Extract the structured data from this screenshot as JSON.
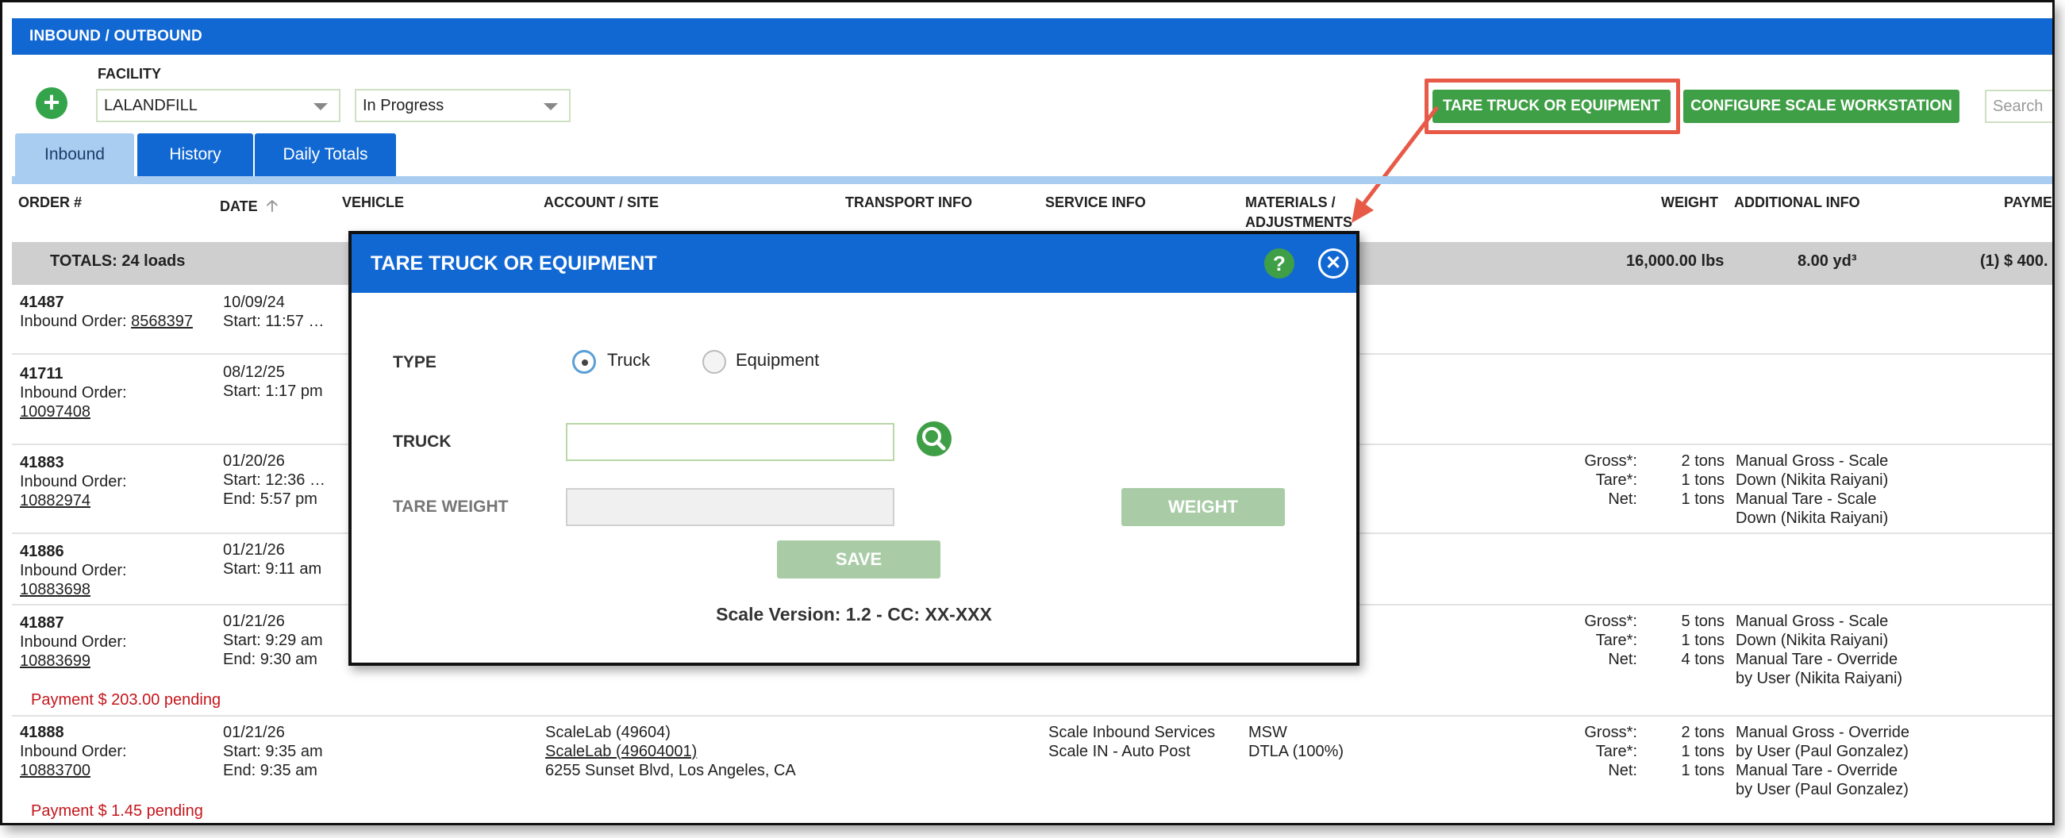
{
  "page": {
    "section_title": "INBOUND / OUTBOUND",
    "facility_label": "FACILITY",
    "facility_value": "LALANDFILL",
    "status_value": "In Progress",
    "tare_button": "TARE TRUCK OR EQUIPMENT",
    "configure_button": "CONFIGURE SCALE WORKSTATION",
    "search_placeholder": "Search"
  },
  "tabs": [
    {
      "label": "Inbound",
      "active": true
    },
    {
      "label": "History",
      "active": false
    },
    {
      "label": "Daily Totals",
      "active": false
    }
  ],
  "columns": {
    "order": "ORDER #",
    "date": "DATE",
    "vehicle": "VEHICLE",
    "account": "ACCOUNT / SITE",
    "transport": "TRANSPORT INFO",
    "service": "SERVICE INFO",
    "materials_line1": "MATERIALS /",
    "materials_line2": "ADJUSTMENTS",
    "weight": "WEIGHT",
    "additional": "ADDITIONAL INFO",
    "payment": "PAYME"
  },
  "totals": {
    "label": "TOTALS: 24 loads",
    "weight": "16,000.00 lbs",
    "volume": "8.00 yd³",
    "payment": "(1) $ 400."
  },
  "rows": [
    {
      "order": "41487",
      "order_label": "Inbound Order:",
      "order_link": "8568397",
      "date": "10/09/24",
      "start": "Start: 11:57 …"
    },
    {
      "order": "41711",
      "order_label": "Inbound Order:",
      "order_link": "10097408",
      "date": "08/12/25",
      "start": "Start: 1:17 pm"
    },
    {
      "order": "41883",
      "order_label": "Inbound Order:",
      "order_link": "10882974",
      "date": "01/20/26",
      "start": "Start: 12:36 …",
      "end": "End: 5:57 pm",
      "gross_label": "Gross*:",
      "gross": "2 tons",
      "tare_label": "Tare*:",
      "tare": "1 tons",
      "net_label": "Net:",
      "net": "1 tons",
      "info1": "Manual Gross - Scale",
      "info2": "Down (Nikita Raiyani)",
      "info3": "Manual Tare - Scale",
      "info4": "Down (Nikita Raiyani)"
    },
    {
      "order": "41886",
      "order_label": "Inbound Order:",
      "order_link": "10883698",
      "date": "01/21/26",
      "start": "Start: 9:11 am"
    },
    {
      "order": "41887",
      "order_label": "Inbound Order:",
      "order_link": "10883699",
      "date": "01/21/26",
      "start": "Start: 9:29 am",
      "end": "End: 9:30 am",
      "gross_label": "Gross*:",
      "gross": "5 tons",
      "tare_label": "Tare*:",
      "tare": "1 tons",
      "net_label": "Net:",
      "net": "4 tons",
      "info1": "Manual Gross - Scale",
      "info2": "Down (Nikita Raiyani)",
      "info3": "Manual Tare - Override",
      "info4": "by User (Nikita Raiyani)",
      "pending": "Payment $ 203.00 pending"
    },
    {
      "order": "41888",
      "order_label": "Inbound Order:",
      "order_link": "10883700",
      "date": "01/21/26",
      "start": "Start: 9:35 am",
      "end": "End: 9:35 am",
      "account1": "ScaleLab (49604)",
      "account2": "ScaleLab (49604001)",
      "account3": "6255 Sunset Blvd, Los Angeles, CA",
      "service1": "Scale Inbound Services",
      "service2": "Scale IN - Auto Post",
      "material1": "MSW",
      "material2": "DTLA (100%)",
      "gross_label": "Gross*:",
      "gross": "2 tons",
      "tare_label": "Tare*:",
      "tare": "1 tons",
      "net_label": "Net:",
      "net": "1 tons",
      "info1": "Manual Gross - Override",
      "info2": "by User (Paul Gonzalez)",
      "info3": "Manual Tare - Override",
      "info4": "by User (Paul Gonzalez)",
      "pending": "Payment $ 1.45 pending"
    }
  ],
  "modal": {
    "title": "TARE TRUCK OR EQUIPMENT",
    "help": "?",
    "type_label": "TYPE",
    "option_truck": "Truck",
    "option_equipment": "Equipment",
    "truck_label": "TRUCK",
    "tare_weight_label": "TARE WEIGHT",
    "weight_button": "WEIGHT",
    "save_button": "SAVE",
    "scale_version": "Scale Version: 1.2 - CC: XX-XXX"
  },
  "colors": {
    "primary_blue": "#1268d3",
    "green": "#3f9f46",
    "highlight_red": "#e85a48",
    "pending_red": "#c4161c"
  }
}
